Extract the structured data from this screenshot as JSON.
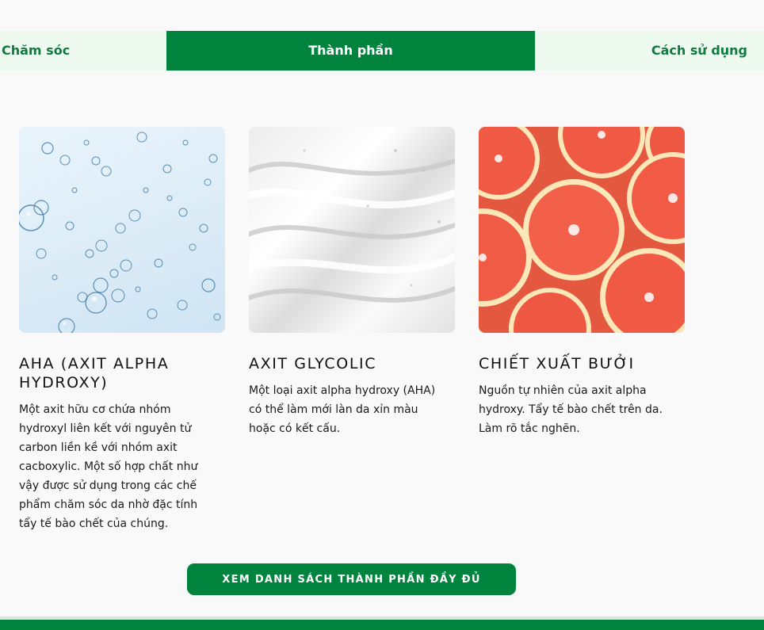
{
  "tabs": [
    {
      "label": "Chăm sóc"
    },
    {
      "label": "Thành phần"
    },
    {
      "label": "Cách sử dụng"
    }
  ],
  "ingredients": [
    {
      "title": "AHA (AXIT ALPHA HYDROXY)",
      "description": "Một axit hữu cơ chứa nhóm hydroxyl liên kết với nguyên tử carbon liền kề với nhóm axit cacboxylic. Một số hợp chất như vậy được sử dụng trong các chế phẩm chăm sóc da nhờ đặc tính tẩy tế bào chết của chúng.",
      "image": "water-bubbles-image"
    },
    {
      "title": "AXIT GLYCOLIC",
      "description": "Một loại axit alpha hydroxy (AHA) có thể làm mới làn da xỉn màu hoặc có kết cấu.",
      "image": "white-cream-texture-image"
    },
    {
      "title": "CHIẾT XUẤT BƯỞI",
      "description": "Nguồn tự nhiên của axit alpha hydroxy. Tẩy tế bào chết trên da. Làm rõ tắc nghẽn.",
      "image": "grapefruit-slices-image"
    }
  ],
  "cta": {
    "label": "XEM DANH SÁCH THÀNH PHẦN ĐẦY ĐỦ"
  },
  "colors": {
    "brand_green": "#00843d",
    "tab_inactive_bg": "#eefaf0",
    "tab_inactive_text": "#117a3f"
  }
}
